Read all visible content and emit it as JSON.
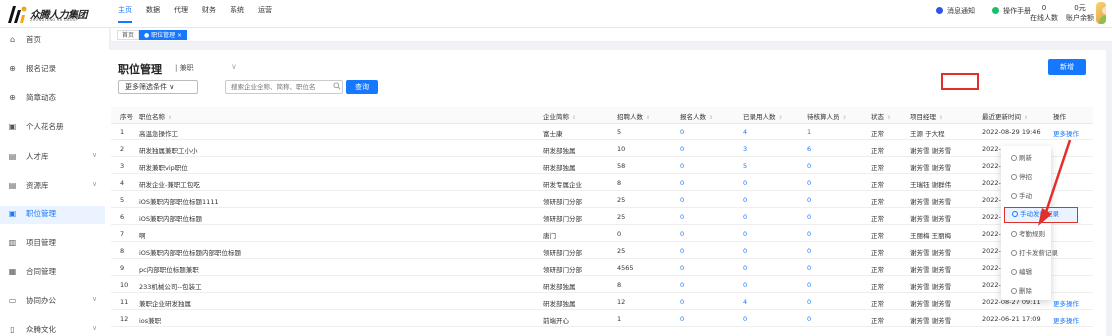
{
  "brand": {
    "name": "众腾人力集团",
    "sub": "ZHONGTENG HR GROUP"
  },
  "top_nav": [
    {
      "label": "主页",
      "active": true
    },
    {
      "label": "数据",
      "active": false
    },
    {
      "label": "代理",
      "active": false
    },
    {
      "label": "财务",
      "active": false
    },
    {
      "label": "系统",
      "active": false
    },
    {
      "label": "运营",
      "active": false
    }
  ],
  "top_right": {
    "notice_label": "消息通知",
    "manual_label": "操作手册",
    "online_count": "0",
    "online_label": "在线人数",
    "balance_value": "0元",
    "balance_label": "账户余额"
  },
  "sidebar": [
    {
      "label": "首页",
      "icon": "home-icon",
      "glyph": "⌂",
      "chevron": false,
      "active": false
    },
    {
      "label": "报名记录",
      "icon": "record-icon",
      "glyph": "⊕",
      "chevron": false,
      "active": false
    },
    {
      "label": "简章动态",
      "icon": "news-icon",
      "glyph": "⊕",
      "chevron": false,
      "active": false
    },
    {
      "label": "个人花名册",
      "icon": "roster-icon",
      "glyph": "▣",
      "chevron": false,
      "active": false
    },
    {
      "label": "人才库",
      "icon": "talent-icon",
      "glyph": "▤",
      "chevron": true,
      "active": false
    },
    {
      "label": "资源库",
      "icon": "resource-icon",
      "glyph": "▤",
      "chevron": true,
      "active": false
    },
    {
      "label": "职位管理",
      "icon": "job-icon",
      "glyph": "▣",
      "chevron": false,
      "active": true
    },
    {
      "label": "项目管理",
      "icon": "project-icon",
      "glyph": "▥",
      "chevron": false,
      "active": false
    },
    {
      "label": "合同管理",
      "icon": "contract-icon",
      "glyph": "▦",
      "chevron": false,
      "active": false
    },
    {
      "label": "协同办公",
      "icon": "office-icon",
      "glyph": "▭",
      "chevron": true,
      "active": false
    },
    {
      "label": "众腾文化",
      "icon": "culture-icon",
      "glyph": "▯",
      "chevron": true,
      "active": false
    }
  ],
  "tabs": [
    {
      "label": "首页",
      "active": false
    },
    {
      "label": "● 职位管理 ×",
      "active": true
    }
  ],
  "page": {
    "title": "职位管理",
    "subtitle": "| 兼职",
    "new_button": "新增",
    "filter_button": "更多筛选条件 ∨",
    "search_placeholder": "搜索企业全称、简称、职位名",
    "query_button": "查询"
  },
  "table": {
    "headers": [
      "序号",
      "职位名称",
      "企业简称",
      "招聘人数",
      "报名人数",
      "已录用人数",
      "待核算人员",
      "状态",
      "项目经理",
      "最近更新时间",
      "操作"
    ],
    "rows": [
      [
        "1",
        "高温急操作工",
        "富士康",
        "5",
        "0",
        "4",
        "1",
        "正常",
        "王源 于大程",
        "2022-08-29 19:46",
        "更多操作"
      ],
      [
        "2",
        "研发独属兼职工小小",
        "研发部独属",
        "10",
        "0",
        "3",
        "6",
        "正常",
        "谢芳雪 谢芳雪",
        "2022-0",
        ""
      ],
      [
        "3",
        "研发兼职vip职位",
        "研发部独属",
        "58",
        "0",
        "5",
        "0",
        "正常",
        "谢芳雪 谢芳雪",
        "2022-0",
        ""
      ],
      [
        "4",
        "研发企业-兼职工包吃",
        "研发专属企业",
        "8",
        "0",
        "0",
        "0",
        "正常",
        "王瑞钰 谢群伟",
        "2022-0",
        ""
      ],
      [
        "5",
        "iOS兼职内部职位标题1111",
        "领研部门分部",
        "25",
        "0",
        "0",
        "0",
        "正常",
        "谢芳雪 谢芳雪",
        "2022-0",
        ""
      ],
      [
        "6",
        "iOS兼职内部职位标题",
        "领研部门分部",
        "25",
        "0",
        "0",
        "0",
        "正常",
        "谢芳雪 谢芳雪",
        "2022-0",
        ""
      ],
      [
        "7",
        "啊",
        "唐门",
        "0",
        "0",
        "0",
        "0",
        "正常",
        "王丽梅 王丽梅",
        "2022-0",
        ""
      ],
      [
        "8",
        "iOS兼职内部职位标题内部职位标题",
        "领研部门分部",
        "25",
        "0",
        "0",
        "0",
        "正常",
        "谢芳雪 谢芳雪",
        "2022-0",
        ""
      ],
      [
        "9",
        "pc内部职位标题兼职",
        "领研部门分部",
        "4565",
        "0",
        "0",
        "0",
        "正常",
        "谢芳雪 谢芳雪",
        "2022-0",
        ""
      ],
      [
        "10",
        "233机械公司--包装工",
        "研发部独属",
        "8",
        "0",
        "0",
        "0",
        "正常",
        "谢芳雪 谢芳雪",
        "2022-0",
        ""
      ],
      [
        "11",
        "兼职企业研发独属",
        "研发部独属",
        "12",
        "0",
        "4",
        "0",
        "正常",
        "谢芳雪 谢芳雪",
        "2022-08-27 09:11",
        "更多操作"
      ],
      [
        "12",
        "ios兼职",
        "前端开心",
        "1",
        "0",
        "0",
        "0",
        "正常",
        "谢芳雪 谢芳雪",
        "2022-06-21 17:09",
        "更多操作"
      ]
    ]
  },
  "dropdown": [
    {
      "label": "刷新",
      "highlight": false
    },
    {
      "label": "停招",
      "highlight": false
    },
    {
      "label": "手动",
      "highlight": false
    },
    {
      "label": "手动发薪记录",
      "highlight": true
    },
    {
      "label": "考勤规则",
      "highlight": false
    },
    {
      "label": "打卡发薪记录",
      "highlight": false
    },
    {
      "label": "编辑",
      "highlight": false
    },
    {
      "label": "删除",
      "highlight": false
    }
  ],
  "colors": {
    "accent": "#1677ff",
    "annotation": "#e0302a"
  }
}
